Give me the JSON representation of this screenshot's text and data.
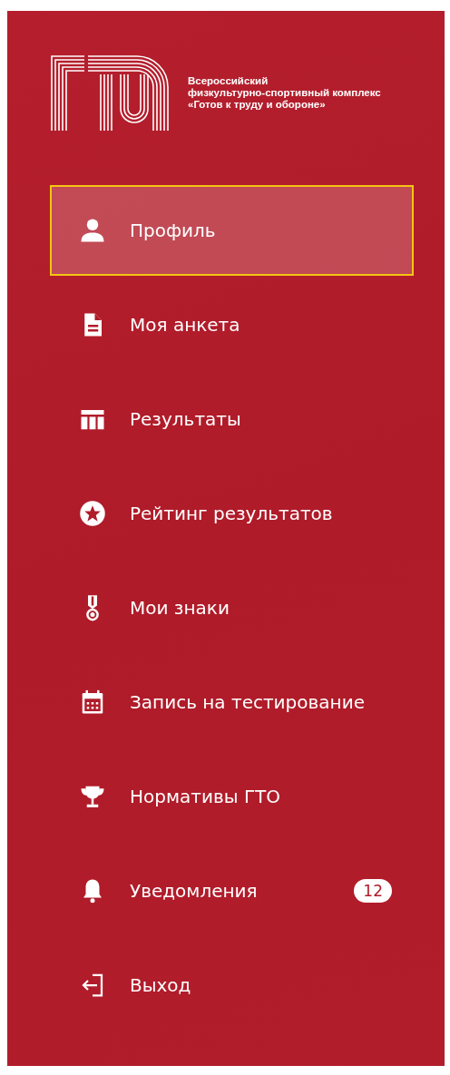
{
  "logo": {
    "tagline": [
      "Всероссийский",
      "физкультурно-спортивный комплекс",
      "«Готов к труду и обороне»"
    ]
  },
  "menu": [
    {
      "label": "Профиль",
      "selected": true
    },
    {
      "label": "Моя анкета",
      "selected": false
    },
    {
      "label": "Результаты",
      "selected": false
    },
    {
      "label": "Рейтинг результатов",
      "selected": false
    },
    {
      "label": "Мои знаки",
      "selected": false
    },
    {
      "label": "Запись на тестирование",
      "selected": false
    },
    {
      "label": "Нормативы ГТО",
      "selected": false
    },
    {
      "label": "Уведомления",
      "selected": false,
      "badge": "12"
    },
    {
      "label": "Выход",
      "selected": false
    }
  ]
}
